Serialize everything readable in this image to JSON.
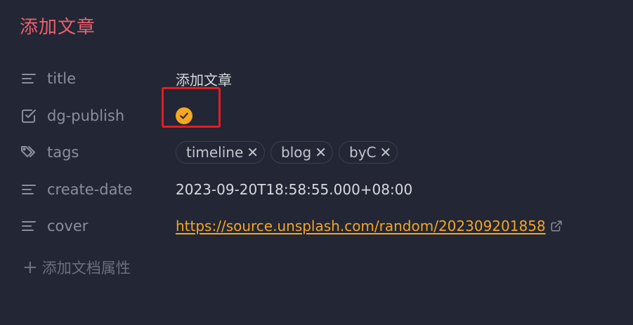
{
  "page": {
    "title": "添加文章"
  },
  "properties": [
    {
      "key": "title",
      "icon": "text-lines-icon",
      "value": "添加文章"
    },
    {
      "key": "dg-publish",
      "icon": "checkbox-icon",
      "value": true
    },
    {
      "key": "tags",
      "icon": "tags-icon",
      "tags": [
        "timeline",
        "blog",
        "byC"
      ]
    },
    {
      "key": "create-date",
      "icon": "text-lines-icon",
      "value": "2023-09-20T18:58:55.000+08:00"
    },
    {
      "key": "cover",
      "icon": "text-lines-icon",
      "value": "https://source.unsplash.com/random/202309201858"
    }
  ],
  "add_property": {
    "label": "添加文档属性"
  },
  "colors": {
    "background": "#232634",
    "title": "#ee5f6f",
    "accent": "#f5a623",
    "highlight": "#e51c23"
  }
}
